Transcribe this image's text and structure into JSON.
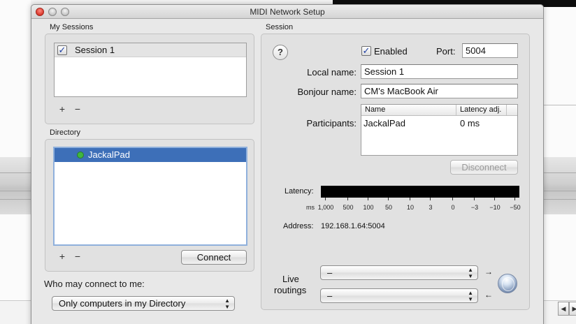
{
  "window": {
    "title": "MIDI Network Setup"
  },
  "my_sessions": {
    "label": "My Sessions",
    "items": [
      {
        "name": "Session 1",
        "checked": true
      }
    ],
    "add_label": "+",
    "remove_label": "−"
  },
  "directory": {
    "label": "Directory",
    "items": [
      {
        "name": "JackalPad",
        "status_color": "#3fb63f",
        "selected": true
      }
    ],
    "add_label": "+",
    "remove_label": "−",
    "connect_label": "Connect"
  },
  "who_may_connect": {
    "label": "Who may connect to me:",
    "selected": "Only computers in my Directory"
  },
  "session": {
    "label": "Session",
    "help_label": "?",
    "enabled_label": "Enabled",
    "enabled_checked": true,
    "port_label": "Port:",
    "port_value": "5004",
    "local_name_label": "Local name:",
    "local_name_value": "Session 1",
    "bonjour_name_label": "Bonjour name:",
    "bonjour_name_value": "CM's MacBook Air",
    "participants_label": "Participants:",
    "participants_columns": [
      "Name",
      "Latency adj."
    ],
    "participants_rows": [
      {
        "name": "JackalPad",
        "latency": "0 ms"
      }
    ],
    "disconnect_label": "Disconnect",
    "latency_label": "Latency:",
    "latency_unit": "ms",
    "latency_ticks": [
      "1,000",
      "500",
      "100",
      "50",
      "10",
      "3",
      "0",
      "−3",
      "−10",
      "−50"
    ],
    "address_label": "Address:",
    "address_value": "192.168.1.64:5004",
    "live_routings_label_1": "Live",
    "live_routings_label_2": "routings",
    "routing_in_value": "–",
    "routing_out_value": "–"
  },
  "colors": {
    "selection": "#3d6fb8",
    "enabled_check": "#1d3fa3",
    "status_dot": "#3fb63f"
  },
  "icons": {
    "window_close": "close-icon",
    "window_minimize": "minimize-icon",
    "window_zoom": "zoom-icon",
    "help": "help-icon",
    "network": "globe-icon",
    "status": "status-dot-icon"
  }
}
